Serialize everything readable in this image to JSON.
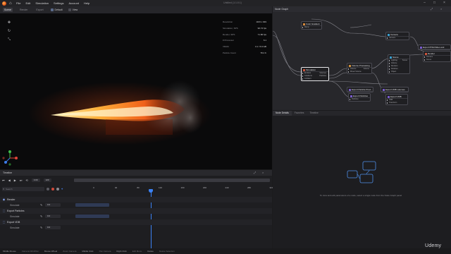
{
  "menubar": {
    "items": [
      "File",
      "Edit",
      "Simulation",
      "Settings",
      "Account",
      "Help"
    ],
    "title": "Untitled (1:1:0:1)"
  },
  "viewport": {
    "tabs": [
      "Scene",
      "Render",
      "Export"
    ],
    "camera": "Default",
    "view": "View"
  },
  "stats": [
    {
      "label": "Resolution",
      "value": "1163 x 649"
    },
    {
      "label": "Simulation, SPS",
      "value": "90.74 fps"
    },
    {
      "label": "Render, SPS",
      "value": "71.86 fps"
    },
    {
      "label": "# Processor",
      "value": "6.1"
    },
    {
      "label": "VRAM",
      "value": "3.1 / 5.9 GB"
    },
    {
      "label": "Particle Count",
      "value": "78.4 K"
    }
  ],
  "timeline": {
    "title": "Timeline",
    "start_frame": "0.00",
    "end_frame": "120",
    "search_placeholder": "Search",
    "ruler_ticks": [
      "0",
      "40",
      "80",
      "120",
      "160",
      "200",
      "240",
      "280",
      "320"
    ],
    "playhead_frame": 140,
    "tracks": [
      {
        "name": "Render",
        "sub": "Simulate",
        "key": "0.0"
      },
      {
        "name": "Export Particles",
        "sub": "Simulate",
        "key": "0.0"
      },
      {
        "name": "Export VDB",
        "sub": "Simulate",
        "key": "0.0"
      }
    ]
  },
  "statusbar": [
    {
      "key": "Middle Mouse",
      "desc": "Camera Orbit/Pan"
    },
    {
      "key": "Mouse Wheel",
      "desc": "Zoom Camera"
    },
    {
      "key": "Middle Click",
      "desc": "Pan Camera"
    },
    {
      "key": "Right Click",
      "desc": "Edit Menu"
    },
    {
      "key": "Delete",
      "desc": "Delete Selection"
    }
  ],
  "node_graph": {
    "title": "Node Graph",
    "nodes": {
      "color_gradient": {
        "title": "Color Gradient",
        "ports": [
          "Ramp"
        ]
      },
      "camera": {
        "title": "Camera",
        "ports": [
          "Camera"
        ]
      },
      "export_png": {
        "title": "Export PNG/Video and Image Sequence"
      },
      "simulation": {
        "title": "Simulation",
        "ports": [
          "Emitters",
          "Gradients",
          "Colliders"
        ],
        "out": [
          "Volumes",
          "Particles"
        ]
      },
      "volume_processing": {
        "title": "Volume Processing",
        "ports": [
          "Volume",
          "Mixed Volume"
        ],
        "out": [
          "Volume"
        ]
      },
      "scene": {
        "title": "Scene",
        "ports": [
          "Lighting",
          "Volume",
          "Renders",
          "Particles",
          "Object"
        ],
        "out": [
          "Scene"
        ]
      },
      "render": {
        "title": "Render",
        "ports": [
          "Camera",
          "Scene"
        ]
      },
      "export_particle_preview": {
        "title": "Export Particle Previ..."
      },
      "export_vdb_volumes": {
        "title": "Export VDB volumes"
      },
      "export_particles": {
        "title": "Export Particles",
        "ports": [
          "Particles"
        ]
      },
      "export_vdb": {
        "title": "Export VDB",
        "ports": [
          "VDB",
          "Transform"
        ]
      }
    }
  },
  "node_details": {
    "tabs": [
      "Node Details",
      "Favorites",
      "Timeline"
    ],
    "message": "To view and edit parameters of a node, select a single node from the Node Graph panel"
  },
  "watermark": "Udemy",
  "colors": {
    "accent": "#3b82f6",
    "node_sim": "#d0543a",
    "node_scene": "#3aa0d0",
    "node_export": "#7a5cd0"
  }
}
